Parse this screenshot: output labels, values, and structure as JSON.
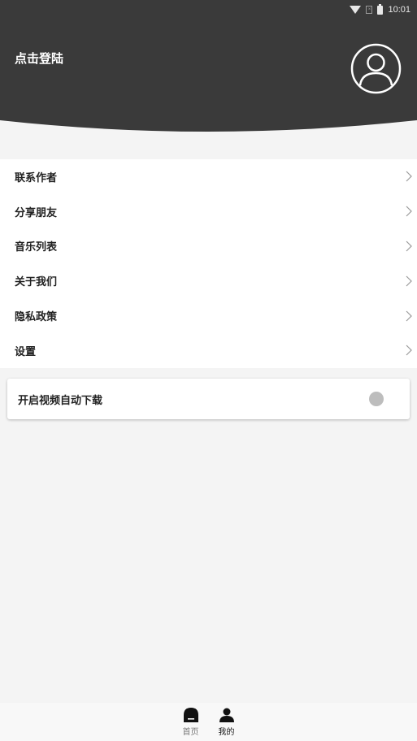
{
  "status_bar": {
    "time": "10:01",
    "icons": [
      "wifi-icon",
      "no-sim-icon",
      "battery-icon"
    ]
  },
  "header": {
    "login_text": "点击登陆",
    "avatar_icon": "user-avatar-icon",
    "background_color": "#3a3a3a"
  },
  "menu": {
    "items": [
      {
        "label": "联系作者",
        "icon": "chevron-right-icon"
      },
      {
        "label": "分享朋友",
        "icon": "chevron-right-icon"
      },
      {
        "label": "音乐列表",
        "icon": "chevron-right-icon"
      },
      {
        "label": "关于我们",
        "icon": "chevron-right-icon"
      },
      {
        "label": "隐私政策",
        "icon": "chevron-right-icon"
      },
      {
        "label": "设置",
        "icon": "chevron-right-icon"
      }
    ]
  },
  "auto_download": {
    "label": "开启视频自动下载",
    "enabled": false
  },
  "bottom_nav": {
    "items": [
      {
        "label": "首页",
        "icon": "home-icon",
        "active": false
      },
      {
        "label": "我的",
        "icon": "person-icon",
        "active": true
      }
    ]
  }
}
